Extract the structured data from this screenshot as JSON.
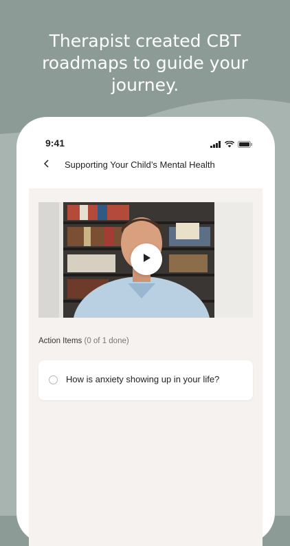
{
  "headline": "Therapist created CBT\nroadmaps to guide your\njourney.",
  "status_bar": {
    "time": "9:41",
    "icons": [
      "signal-icon",
      "wifi-icon",
      "battery-icon"
    ]
  },
  "nav": {
    "back_icon": "chevron-left-icon",
    "title": "Supporting Your Child’s Mental Health"
  },
  "video": {
    "play_icon": "play-icon"
  },
  "action_items": {
    "label": "Action Items",
    "count": "(0 of 1 done)",
    "items": [
      {
        "text": "How is anxiety showing up in your life?",
        "done": false
      }
    ]
  },
  "colors": {
    "background_top": "#8d9b97",
    "background_wave": "#a7b4b0",
    "content_bg": "#f6f2ef",
    "card_bg": "#ffffff"
  }
}
